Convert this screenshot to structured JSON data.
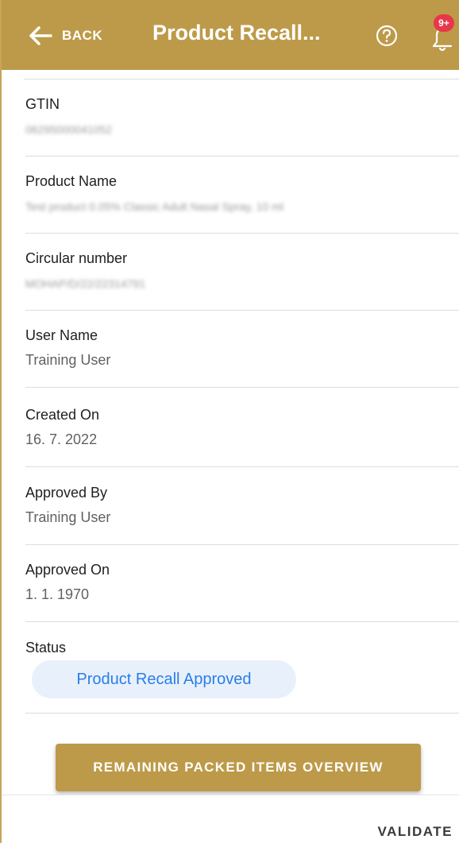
{
  "header": {
    "back_label": "BACK",
    "title": "Product Recall...",
    "notification_badge": "9+",
    "background_color": "#bd9a49",
    "icons": [
      "back-arrow-icon",
      "help-circle-icon",
      "bell-icon"
    ]
  },
  "fields": [
    {
      "label": "GTIN",
      "value": "06295000041052",
      "blurred": true
    },
    {
      "label": "Product Name",
      "value": "Test product 0.05% Classic Adult Nasal Spray, 10 ml",
      "blurred": true
    },
    {
      "label": "Circular number",
      "value": "MOHAP/D/22/22314791",
      "blurred": true
    },
    {
      "label": "User Name",
      "value": "Training User",
      "blurred": false
    },
    {
      "label": "Created On",
      "value": "16. 7. 2022",
      "blurred": false
    },
    {
      "label": "Approved By",
      "value": "Training User",
      "blurred": false
    },
    {
      "label": "Approved On",
      "value": "1. 1. 1970",
      "blurred": false
    }
  ],
  "status": {
    "label": "Status",
    "value": "Product Recall Approved",
    "pill_color": "#e8f1fb",
    "text_color": "#2b7de9"
  },
  "actions": {
    "overview_label": "REMAINING PACKED ITEMS OVERVIEW",
    "validate_label": "VALIDATE"
  }
}
